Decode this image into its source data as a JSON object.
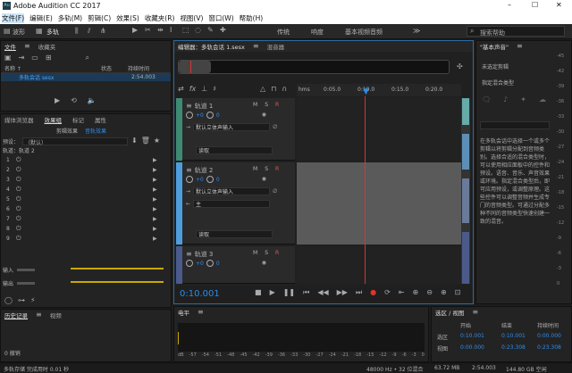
{
  "window": {
    "title": "Adobe Audition CC 2017",
    "min": "–",
    "max": "☐",
    "close": "✕",
    "logo": "Au"
  },
  "menu": [
    "文件(F)",
    "编辑(E)",
    "多轨(M)",
    "剪辑(C)",
    "效果(S)",
    "收藏夹(R)",
    "视图(V)",
    "窗口(W)",
    "帮助(H)"
  ],
  "toolbar": {
    "waveform": "波形",
    "multitrack": "多轨",
    "workspaces": [
      "传统",
      "响度",
      "基本视频音频"
    ],
    "search_placeholder": "搜索帮助"
  },
  "files_panel": {
    "tabs": [
      "文件",
      "收藏夹"
    ],
    "col_name": "名称 ↑",
    "col_status": "状态",
    "col_duration": "持续时间",
    "file_name": "多轨会话 sesx",
    "file_duration": "2:54.003"
  },
  "effects_panel": {
    "tabs": [
      "媒体浏览器",
      "效果组",
      "标记",
      "属性"
    ],
    "subtabs": [
      "剪辑效果",
      "音轨效果"
    ],
    "preset_label": "预设：",
    "preset_value": "（默认）",
    "track_label": "轨道：轨道 2",
    "slots": [
      "1",
      "2",
      "3",
      "4",
      "5",
      "6",
      "7",
      "8",
      "9"
    ],
    "input_label": "输入",
    "output_label": "输出"
  },
  "history": {
    "tabs": [
      "历史记录",
      "视频"
    ],
    "undo_label": "0 撤销"
  },
  "editor": {
    "tabs": [
      "编辑器：多轨会话 1.sesx",
      "混音器"
    ],
    "ruler": [
      "hms",
      "0:05.0",
      "0:10.0",
      "0:15.0",
      "0:20.0"
    ],
    "time": "0:10.001"
  },
  "tracks": [
    {
      "name": "轨道 1",
      "vol": "+0",
      "pan": "0",
      "input": "默认立体声输入",
      "mode": "读取",
      "color": "#3e8a74"
    },
    {
      "name": "轨道 2",
      "vol": "+0",
      "pan": "0",
      "input": "默认立体声输入",
      "output": "主",
      "mode": "读取",
      "color": "#4e9edb"
    },
    {
      "name": "轨道 3",
      "vol": "+0",
      "pan": "0",
      "color": "#4a5a8a"
    }
  ],
  "levels": {
    "title": "电平",
    "scale": [
      "dB",
      "-57",
      "-54",
      "-51",
      "-48",
      "-45",
      "-42",
      "-39",
      "-36",
      "-33",
      "-30",
      "-27",
      "-24",
      "-21",
      "-18",
      "-15",
      "-12",
      "-9",
      "-6",
      "-3",
      "0"
    ]
  },
  "selection": {
    "title": "选区 / 视图",
    "headers": [
      "开始",
      "结束",
      "持续时间"
    ],
    "rows": [
      {
        "label": "选区",
        "start": "0:10.001",
        "end": "0:10.001",
        "dur": "0:00.000"
      },
      {
        "label": "视图",
        "start": "0:00.000",
        "end": "0:23.308",
        "dur": "0:23.308"
      }
    ]
  },
  "status": {
    "left": "多轨存储 完成用时 0.01 秒",
    "rate": "48000 Hz • 32 位混合",
    "size": "63.72 MB",
    "dur": "2:54.003",
    "free": "144.80 GB 空闲"
  },
  "essential": {
    "title": "\"基本声音\"",
    "none_selected": "未选定剪辑",
    "assign_label": "指定混合类型",
    "help": "在多轨会话中选择一个或多个剪辑以将剪辑分配到音频类别。选择合适的混合类型时，可以使用相应面板中的控件和预设。语音、音乐、声音效果或环境。指定混合类型后，即可应用预设，或调整原理。这些控件可以调整音频并生成专门的音频类型。可通过分配多种不同的音频类型快速创建一致的混音。"
  },
  "side_meter": [
    "-45",
    "-42",
    "-39",
    "-36",
    "-33",
    "-30",
    "-27",
    "-24",
    "-21",
    "-18",
    "-15",
    "-12",
    "-9",
    "-6",
    "-3",
    "0"
  ]
}
